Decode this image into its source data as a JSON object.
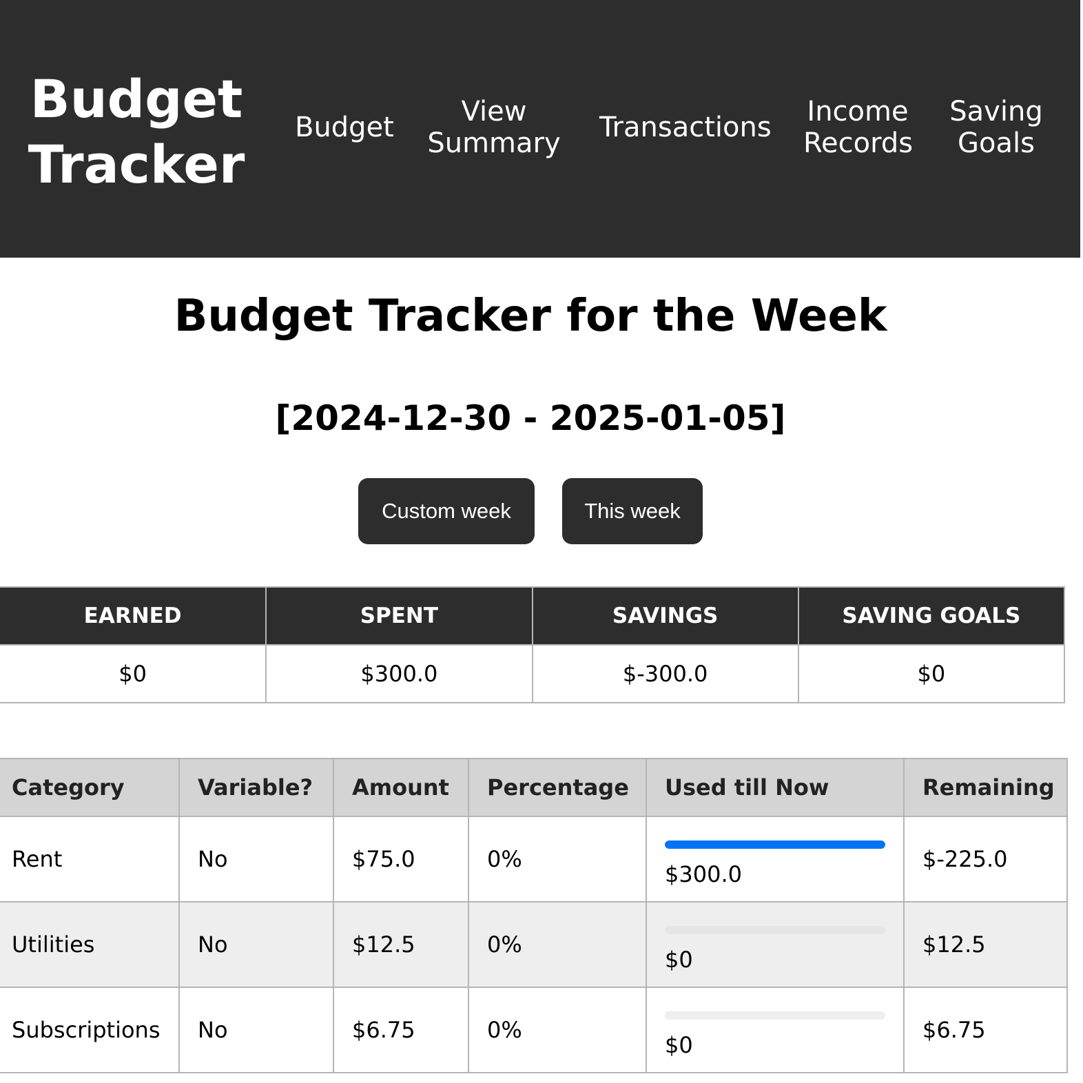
{
  "navbar": {
    "brand_line1": "Budget",
    "brand_line2": "Tracker",
    "items": [
      {
        "line1": "Budget",
        "line2": ""
      },
      {
        "line1": "View",
        "line2": "Summary"
      },
      {
        "line1": "Transactions",
        "line2": ""
      },
      {
        "line1": "Income",
        "line2": "Records"
      },
      {
        "line1": "Saving",
        "line2": "Goals"
      }
    ]
  },
  "main": {
    "title": "Budget Tracker for the Week",
    "week_range": "[2024-12-30 - 2025-01-05]",
    "buttons": {
      "custom_week": "Custom week",
      "this_week": "This week"
    }
  },
  "summary": {
    "headers": [
      "EARNED",
      "SPENT",
      "SAVINGS",
      "SAVING GOALS"
    ],
    "values": [
      "$0",
      "$300.0",
      "$-300.0",
      "$0"
    ]
  },
  "budget_table": {
    "headers": [
      "Category",
      "Variable?",
      "Amount",
      "Percentage",
      "Used till Now",
      "Remaining"
    ],
    "rows": [
      {
        "category": "Rent",
        "variable": "No",
        "amount": "$75.0",
        "percentage": "0%",
        "used": "$300.0",
        "used_progress": 1.0,
        "remaining": "$-225.0"
      },
      {
        "category": "Utilities",
        "variable": "No",
        "amount": "$12.5",
        "percentage": "0%",
        "used": "$0",
        "used_progress": 0.0,
        "remaining": "$12.5"
      },
      {
        "category": "Subscriptions",
        "variable": "No",
        "amount": "$6.75",
        "percentage": "0%",
        "used": "$0",
        "used_progress": 0.0,
        "remaining": "$6.75"
      }
    ]
  },
  "colors": {
    "header_bg": "#2d2d2d",
    "progress_fill": "#0073f5",
    "table_header_bg": "#d4d4d4",
    "alt_row_bg": "#eeeeee"
  }
}
